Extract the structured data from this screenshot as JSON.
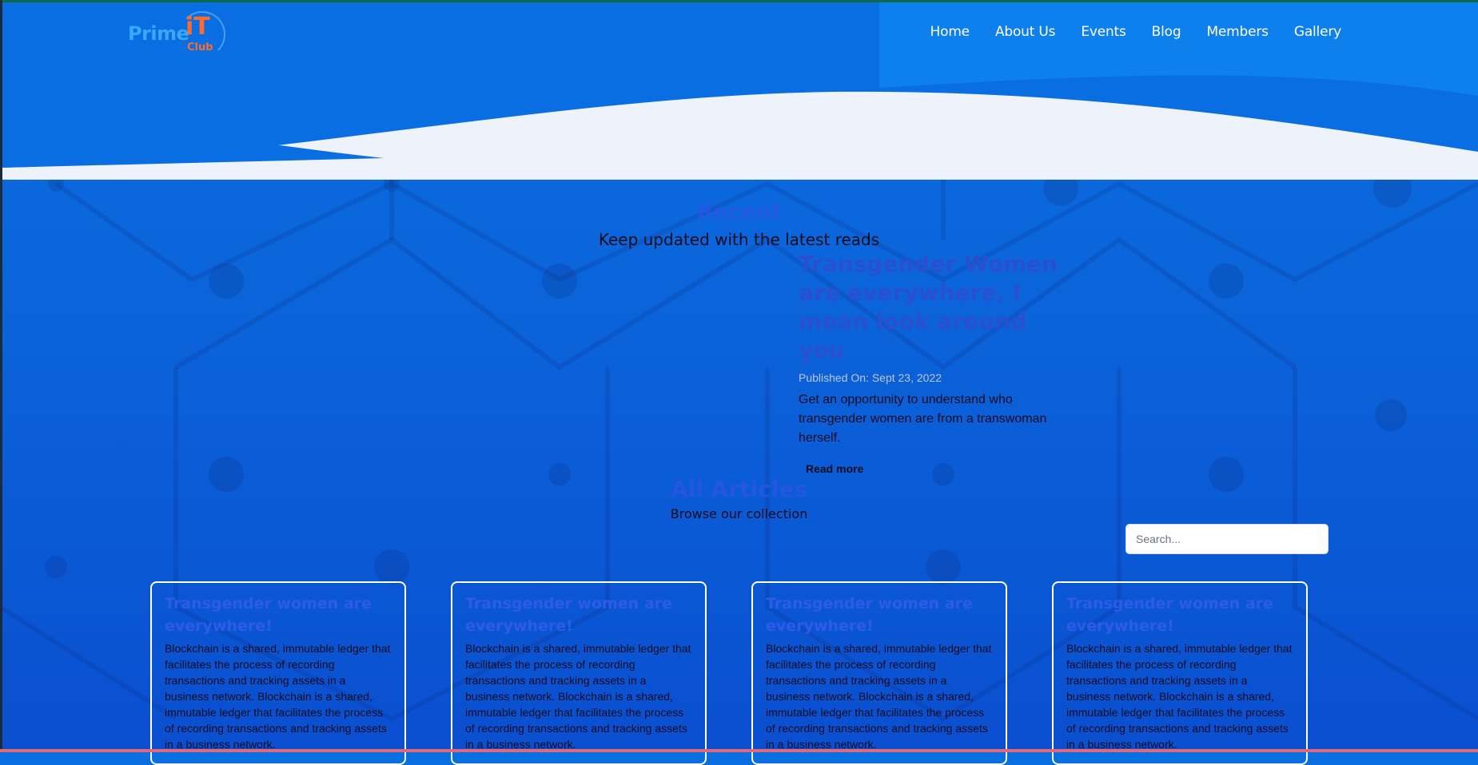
{
  "brand": {
    "logo_prime": "Prime",
    "logo_it": "iT",
    "logo_club": "Club"
  },
  "nav": {
    "items": [
      "Home",
      "About Us",
      "Events",
      "Blog",
      "Members",
      "Gallery"
    ]
  },
  "recent": {
    "title": "Recent",
    "subtitle": "Keep updated with the latest reads",
    "feature": {
      "title": "Transgender Women are everywhere, I mean look around you",
      "date": "Published On: Sept 23, 2022",
      "description": "Get an opportunity to understand who transgender women are from a transwoman herself.",
      "read_more": "Read more"
    }
  },
  "articles": {
    "title": "All Articles",
    "subtitle": "Browse our collection",
    "search_placeholder": "Search...",
    "cards": [
      {
        "title": "Transgender women are everywhere!",
        "body": "Blockchain is a shared, immutable ledger that facilitates the process of recording transactions and tracking assets in a business network. Blockchain is a shared, immutable ledger that facilitates the process of recording transactions and tracking assets in a business network."
      },
      {
        "title": "Transgender women are everywhere!",
        "body": "Blockchain is a shared, immutable ledger that facilitates the process of recording transactions and tracking assets in a business network. Blockchain is a shared, immutable ledger that facilitates the process of recording transactions and tracking assets in a business network."
      },
      {
        "title": "Transgender women are everywhere!",
        "body": "Blockchain is a shared, immutable ledger that facilitates the process of recording transactions and tracking assets in a business network. Blockchain is a shared, immutable ledger that facilitates the process of recording transactions and tracking assets in a business network."
      },
      {
        "title": "Transgender women are everywhere!",
        "body": "Blockchain is a shared, immutable ledger that facilitates the process of recording transactions and tracking assets in a business network. Blockchain is a shared, immutable ledger that facilitates the process of recording transactions and tracking assets in a business network."
      }
    ]
  },
  "colors": {
    "background": "#0b64da",
    "wave": "#eef2fb",
    "accent_title": "#2d55e6",
    "logo_blue": "#3aa8ff",
    "logo_orange": "#ff6b2a"
  }
}
